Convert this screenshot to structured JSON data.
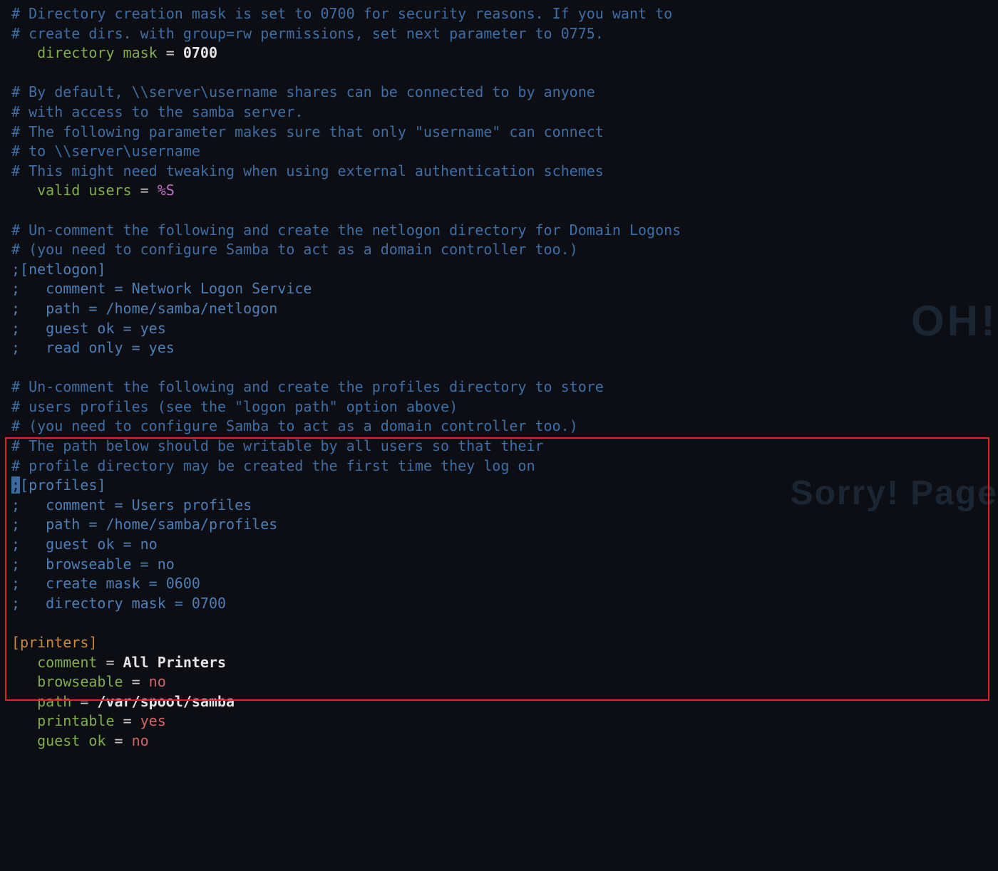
{
  "comments": {
    "c1a": "# Directory creation mask is set to 0700 for security reasons. If you want to",
    "c1b": "# create dirs. with group=rw permissions, set next parameter to 0775.",
    "c2a": "# By default, \\\\server\\username shares can be connected to by anyone",
    "c2b": "# with access to the samba server.",
    "c2c": "# The following parameter makes sure that only \"username\" can connect",
    "c2d": "# to \\\\server\\username",
    "c2e": "# This might need tweaking when using external authentication schemes",
    "c3a": "# Un-comment the following and create the netlogon directory for Domain Logons",
    "c3b": "# (you need to configure Samba to act as a domain controller too.)",
    "c4a": "# Un-comment the following and create the profiles directory to store",
    "c4b": "# users profiles (see the \"logon path\" option above)",
    "c4c": "# (you need to configure Samba to act as a domain controller too.)",
    "c4d": "# The path below should be writable by all users so that their",
    "c4e": "# profile directory may be created the first time they log on"
  },
  "kv": {
    "dirmask_key": "directory mask",
    "dirmask_val": "0700",
    "valid_key": "valid users",
    "valid_val": "%S",
    "netlogon_section": "[netlogon]",
    "netlogon_comment_key": "comment",
    "netlogon_comment_val": "Network Logon Service",
    "netlogon_path_key": "path",
    "netlogon_path_val": "/home/samba/netlogon",
    "netlogon_guest_key": "guest ok",
    "netlogon_guest_val": "yes",
    "netlogon_ro_key": "read only",
    "netlogon_ro_val": "yes",
    "profiles_section": "[profiles]",
    "profiles_comment_key": "comment",
    "profiles_comment_val": "Users profiles",
    "profiles_path_key": "path",
    "profiles_path_val": "/home/samba/profiles",
    "profiles_guest_key": "guest ok",
    "profiles_guest_val": "no",
    "profiles_browse_key": "browseable",
    "profiles_browse_val": "no",
    "profiles_cmask_key": "create mask",
    "profiles_cmask_val": "0600",
    "profiles_dmask_key": "directory mask",
    "profiles_dmask_val": "0700",
    "printers_section": "[printers]",
    "printers_comment_key": "comment",
    "printers_comment_val": "All Printers",
    "printers_browse_key": "browseable",
    "printers_browse_val": "no",
    "printers_path_key": "path",
    "printers_path_val": "/var/spool/samba",
    "printers_printable_key": "printable",
    "printers_printable_val": "yes",
    "printers_guest_key": "guest ok",
    "printers_guest_val": "no"
  },
  "punct": {
    "eq": " = ",
    "semi": ";",
    "semipad": ";   "
  },
  "watermark": {
    "oh": "OH!",
    "sorry": "Sorry! Page"
  }
}
